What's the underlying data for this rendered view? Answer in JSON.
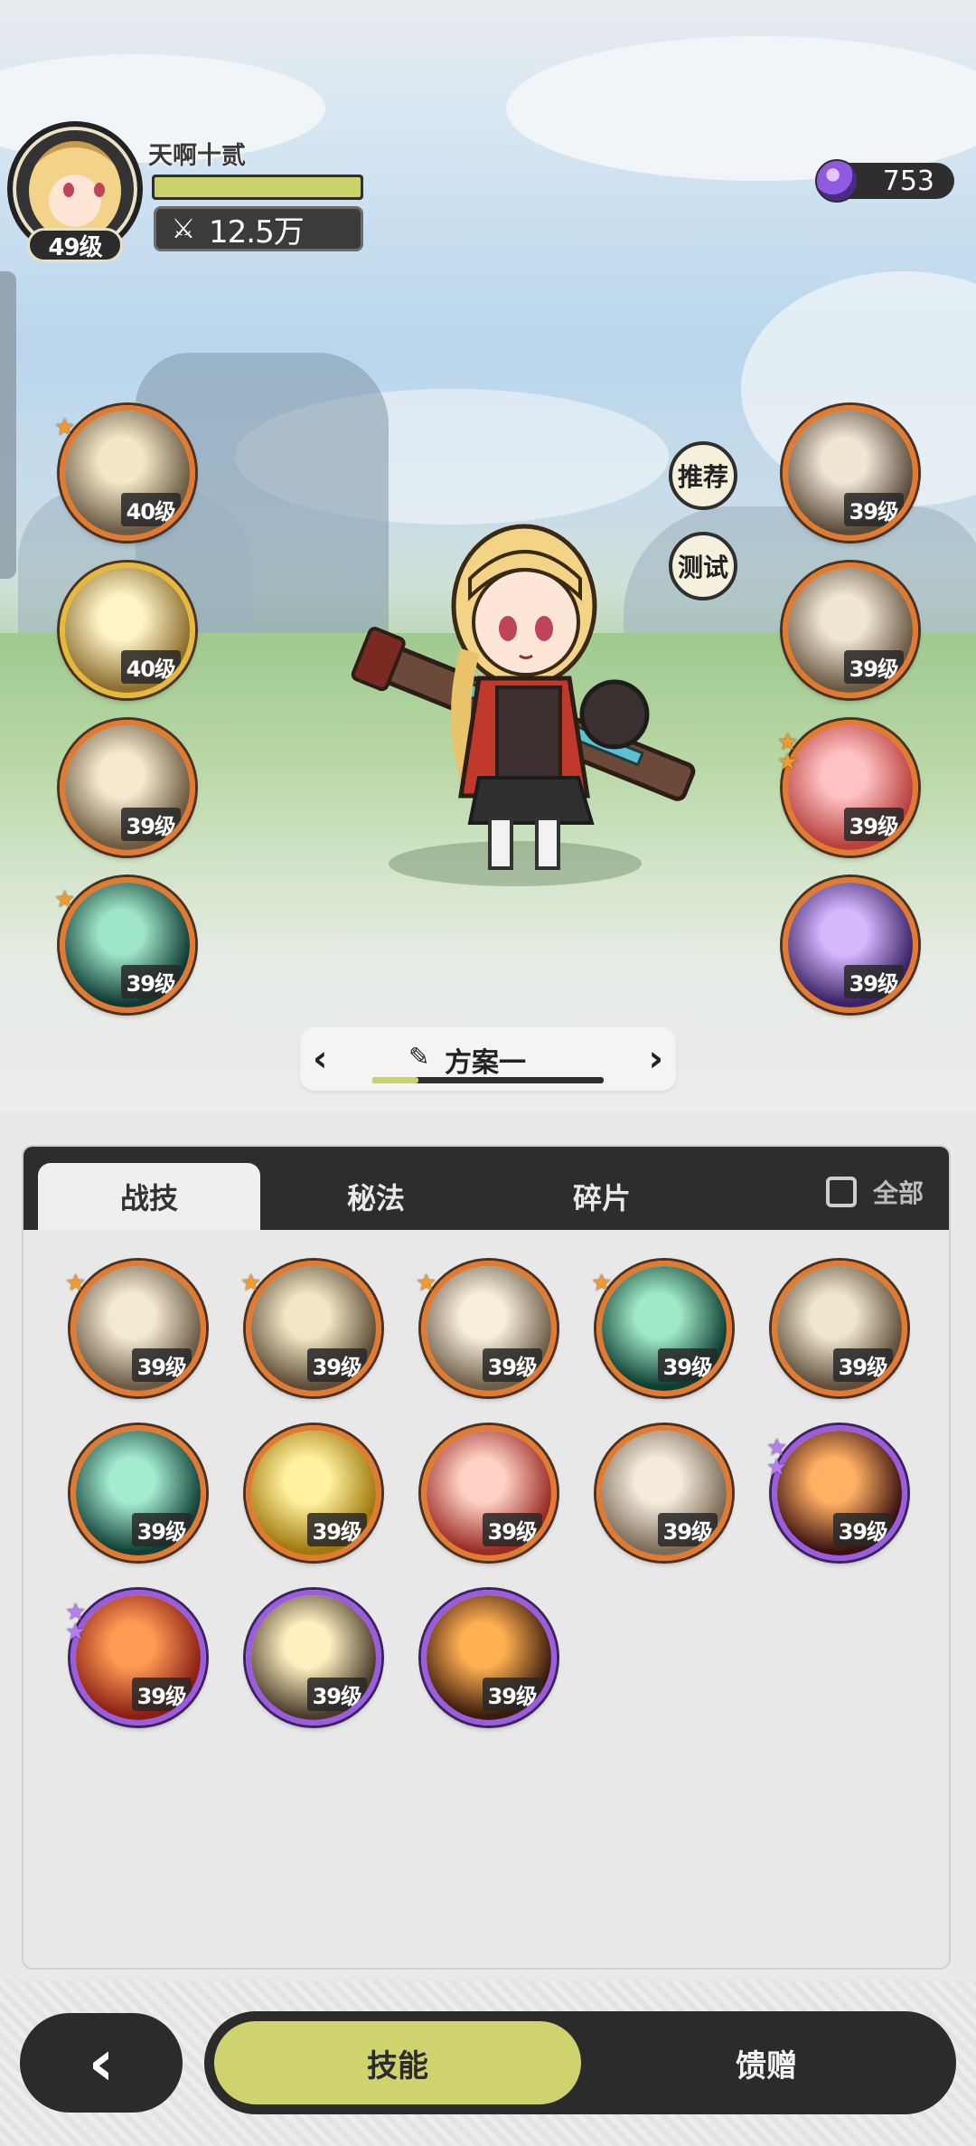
{
  "header": {
    "player_name": "天啊十贰",
    "player_level": "49级",
    "exp_fraction": 1.0,
    "power_value": "12.5万",
    "currency_value": "753"
  },
  "side_buttons": {
    "recommend": "推荐",
    "test": "测试"
  },
  "equipped_left": [
    {
      "level": "40级",
      "frame": "orange",
      "star": "1-orange",
      "icon": "slash-skill-icon"
    },
    {
      "level": "40级",
      "frame": "gold",
      "star": "",
      "icon": "burst-skill-icon"
    },
    {
      "level": "39级",
      "frame": "orange",
      "star": "",
      "icon": "sword-dash-skill-icon"
    },
    {
      "level": "39级",
      "frame": "orange",
      "star": "1-orange",
      "icon": "green-wave-skill-icon"
    }
  ],
  "equipped_right": [
    {
      "level": "39级",
      "frame": "orange",
      "star": "",
      "icon": "crystal-skill-icon"
    },
    {
      "level": "39级",
      "frame": "orange",
      "star": "",
      "icon": "sword-up-skill-icon"
    },
    {
      "level": "39级",
      "frame": "orange",
      "star": "2-orange",
      "icon": "red-cross-skill-icon"
    },
    {
      "level": "39级",
      "frame": "orange",
      "star": "",
      "icon": "purple-beast-skill-icon"
    }
  ],
  "preset": {
    "name": "方案一",
    "progress_fraction": 0.2
  },
  "panel": {
    "tabs": [
      "战技",
      "秘法",
      "碎片"
    ],
    "active_tab": "战技",
    "filter_label": "全部",
    "skills": [
      {
        "level": "39级",
        "frame": "orange",
        "star": "1-orange",
        "icon": "wind-slash-skill-icon"
      },
      {
        "level": "39级",
        "frame": "orange",
        "star": "1-orange",
        "icon": "crescent-skill-icon"
      },
      {
        "level": "39级",
        "frame": "orange",
        "star": "1-orange",
        "icon": "shockwave-skill-icon"
      },
      {
        "level": "39级",
        "frame": "orange",
        "star": "1-orange",
        "icon": "green-sword-skill-icon"
      },
      {
        "level": "39级",
        "frame": "orange",
        "star": "",
        "icon": "whirl-skill-icon"
      },
      {
        "level": "39级",
        "frame": "orange",
        "star": "",
        "icon": "web-skill-icon"
      },
      {
        "level": "39级",
        "frame": "orange",
        "star": "",
        "icon": "golden-up-skill-icon"
      },
      {
        "level": "39级",
        "frame": "orange",
        "star": "",
        "icon": "red-warrior-skill-icon"
      },
      {
        "level": "39级",
        "frame": "orange",
        "star": "",
        "icon": "afterimage-skill-icon"
      },
      {
        "level": "39级",
        "frame": "purple",
        "star": "2-purple",
        "icon": "fire-arc-skill-icon"
      },
      {
        "level": "39级",
        "frame": "purple",
        "star": "2-purple",
        "icon": "fire-emblem-skill-icon"
      },
      {
        "level": "39级",
        "frame": "purple",
        "star": "",
        "icon": "light-blade-skill-icon"
      },
      {
        "level": "39级",
        "frame": "purple",
        "star": "",
        "icon": "flame-crest-skill-icon"
      }
    ]
  },
  "bottom_nav": {
    "back_symbol": "‹",
    "skills_label": "技能",
    "gift_label": "馈赠"
  },
  "colors": {
    "accent_yellow": "#cfd36d",
    "frame_orange": "#e27b2f",
    "frame_gold": "#e7b93a",
    "frame_purple": "#9c5ce0",
    "dark": "#2b2b2b"
  }
}
